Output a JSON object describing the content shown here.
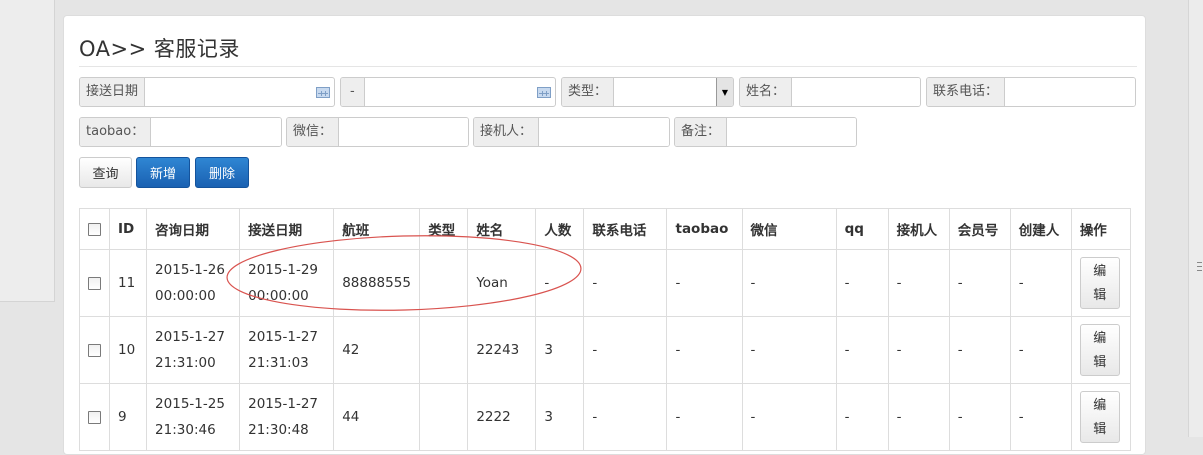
{
  "page": {
    "title": "OA>> 客服记录"
  },
  "filters": {
    "pickup_date_label": "接送日期",
    "pickup_date_from": "",
    "range_separator": "-",
    "pickup_date_to": "",
    "type_label": "类型：",
    "type_selected": "",
    "name_label": "姓名：",
    "name_value": "",
    "phone_label": "联系电话：",
    "phone_value": "",
    "taobao_label": "taobao：",
    "taobao_value": "",
    "wechat_label": "微信：",
    "wechat_value": "",
    "receiver_label": "接机人：",
    "receiver_value": "",
    "remark_label": "备注：",
    "remark_value": ""
  },
  "toolbar": {
    "query_label": "查询",
    "add_label": "新增",
    "delete_label": "删除"
  },
  "table": {
    "columns": [
      "ID",
      "咨询日期",
      "接送日期",
      "航班",
      "类型",
      "姓名",
      "人数",
      "联系电话",
      "taobao",
      "微信",
      "qq",
      "接机人",
      "会员号",
      "创建人",
      "操作"
    ],
    "edit_label": "编\n辑",
    "rows": [
      {
        "id": "11",
        "consult_date": "2015-1-26 00:00:00",
        "pickup_date": "2015-1-29 00:00:00",
        "flight": "88888555",
        "type": "",
        "name": "Yoan",
        "people": "-",
        "phone": "-",
        "taobao": "-",
        "wechat": "-",
        "qq": "-",
        "receiver": "-",
        "member_no": "-",
        "creator": "-"
      },
      {
        "id": "10",
        "consult_date": "2015-1-27 21:31:00",
        "pickup_date": "2015-1-27 21:31:03",
        "flight": "42",
        "type": "",
        "name": "22243",
        "people": "3",
        "phone": "-",
        "taobao": "-",
        "wechat": "-",
        "qq": "-",
        "receiver": "-",
        "member_no": "-",
        "creator": "-"
      },
      {
        "id": "9",
        "consult_date": "2015-1-25 21:30:46",
        "pickup_date": "2015-1-27 21:30:48",
        "flight": "44",
        "type": "",
        "name": "2222",
        "people": "3",
        "phone": "-",
        "taobao": "-",
        "wechat": "-",
        "qq": "-",
        "receiver": "-",
        "member_no": "-",
        "creator": "-"
      }
    ]
  },
  "colors": {
    "primary": "#1a61b2",
    "annotation": "#d9534f",
    "border": "#dddddd"
  }
}
